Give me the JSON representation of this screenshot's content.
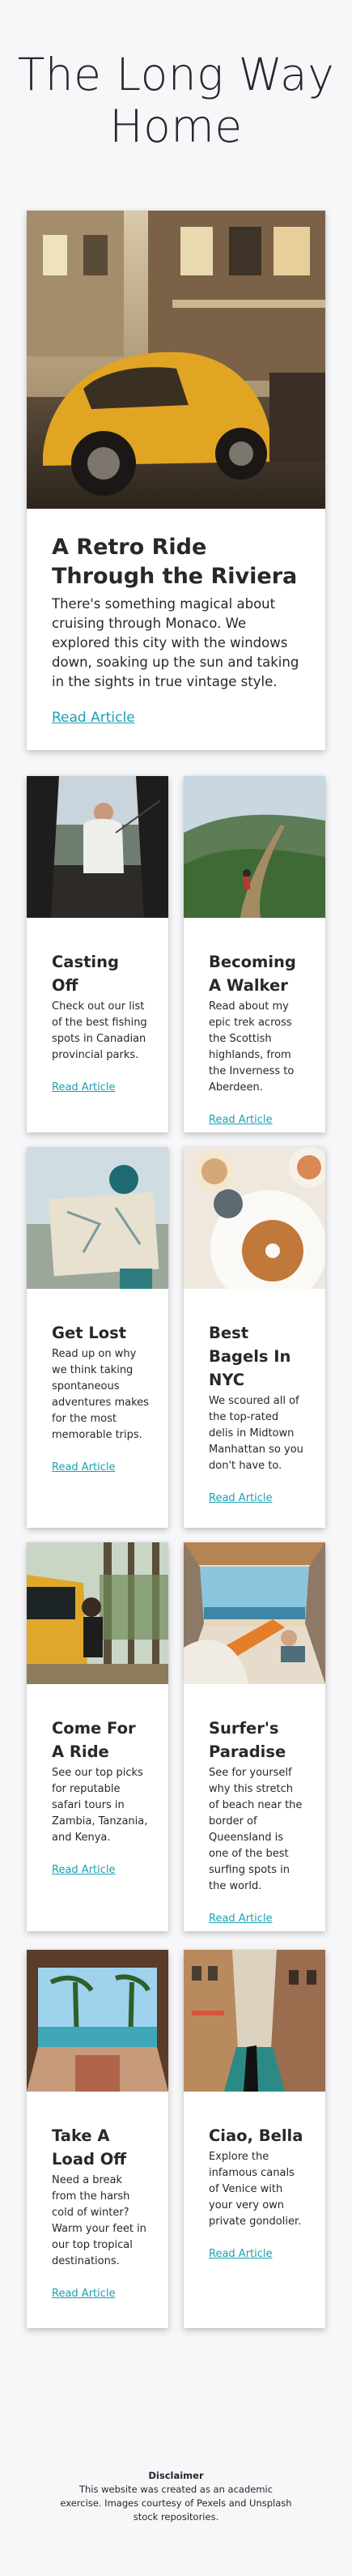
{
  "site": {
    "title": "The Long Way Home"
  },
  "featured": {
    "title": "A Retro Ride Through the Riviera",
    "text": "There's something magical about cruising through Monaco. We explored this city with the windows down, soaking up the sun and taking in the sights in true vintage style.",
    "link": "Read Article",
    "image_icon": "yellow-vintage-car-photo"
  },
  "articles": [
    {
      "title": "Casting Off",
      "text": "Check out our list of the best fishing spots in Canadian provincial parks.",
      "link": "Read Article",
      "image_icon": "fishing-photo"
    },
    {
      "title": "Becoming A Walker",
      "text": "Read about my epic trek across the Scottish highlands, from the Inverness to Aberdeen.",
      "link": "Read Article",
      "image_icon": "hiking-ridge-photo"
    },
    {
      "title": "Get Lost",
      "text": "Read up on why we think taking spontaneous adventures makes for the most memorable trips.",
      "link": "Read Article",
      "image_icon": "map-reading-photo"
    },
    {
      "title": "Best Bagels In NYC",
      "text": "We scoured all of the top-rated delis in Midtown Manhattan so you don't have to.",
      "link": "Read Article",
      "image_icon": "bagel-breakfast-photo"
    },
    {
      "title": "Come For A Ride",
      "text": "See our top picks for reputable safari tours in Zambia, Tanzania, and Kenya.",
      "link": "Read Article",
      "image_icon": "yellow-van-forest-photo"
    },
    {
      "title": "Surfer's Paradise",
      "text": "See for yourself why this stretch of beach near the border of Queensland is one of the best surfing spots in the world.",
      "link": "Read Article",
      "image_icon": "van-beach-view-photo"
    },
    {
      "title": "Take A Load Off",
      "text": "Need a break from the harsh cold of winter? Warm your feet in our top tropical destinations.",
      "link": "Read Article",
      "image_icon": "tropical-pool-photo"
    },
    {
      "title": "Ciao, Bella",
      "text": "Explore the infamous canals of Venice with your very own private gondolier.",
      "link": "Read Article",
      "image_icon": "venice-canal-photo"
    }
  ],
  "footer": {
    "heading": "Disclaimer",
    "text": "This website was created as an academic exercise. Images courtesy of Pexels and Unsplash stock repositories."
  }
}
